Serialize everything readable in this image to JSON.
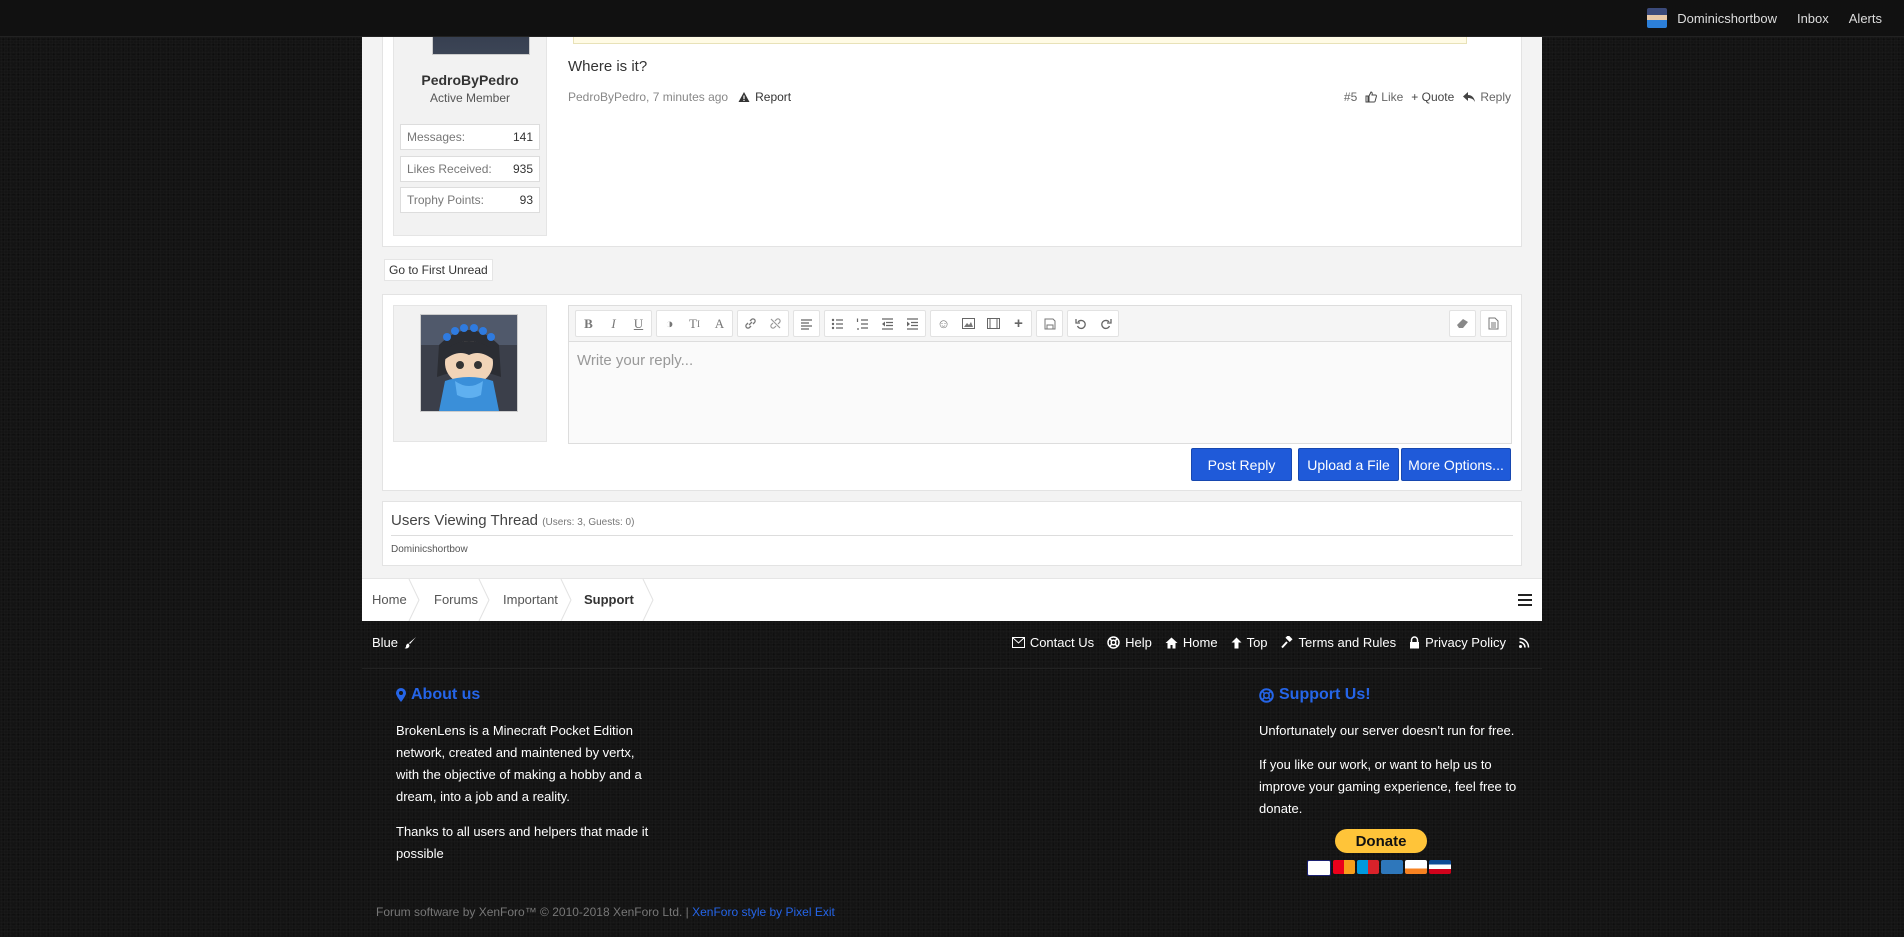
{
  "topbar": {
    "username": "Dominicshortbow",
    "inbox": "Inbox",
    "alerts": "Alerts"
  },
  "post": {
    "author": "PedroByPedro",
    "author_title": "Active Member",
    "stats": [
      {
        "label": "Messages:",
        "value": "141"
      },
      {
        "label": "Likes Received:",
        "value": "935"
      },
      {
        "label": "Trophy Points:",
        "value": "93"
      }
    ],
    "message": "Where is it?",
    "meta_author": "PedroByPedro",
    "meta_time": ", 7 minutes ago",
    "report": "Report",
    "number": "#5",
    "like": "Like",
    "quote": "+ Quote",
    "reply": "Reply"
  },
  "first_unread": "Go to First Unread",
  "reply_box": {
    "placeholder": "Write your reply...",
    "post_reply": "Post Reply",
    "upload": "Upload a File",
    "more": "More Options..."
  },
  "viewers": {
    "title": "Users Viewing Thread",
    "counts": "(Users: 3, Guests: 0)",
    "names": "Dominicshortbow"
  },
  "breadcrumb": [
    "Home",
    "Forums",
    "Important",
    "Support"
  ],
  "footer": {
    "style": "Blue",
    "links": [
      "Contact Us",
      "Help",
      "Home",
      "Top",
      "Terms and Rules",
      "Privacy Policy"
    ],
    "about_title": "About us",
    "about_p1_l1": "BrokenLens is a Minecraft Pocket Edition",
    "about_p1_l2": "network, created and maintened by vertx,",
    "about_p1_l3": "with the objective of making a hobby and a",
    "about_p1_l4": "dream, into a job and a reality.",
    "about_p2_l1": "Thanks to all users and helpers that made it",
    "about_p2_l2": "possible",
    "support_title": "Support Us!",
    "support_p1": "Unfortunately our server doesn't run for free.",
    "support_p2_l1": "If you like our work, or want to help us to",
    "support_p2_l2": "improve your gaming experience, feel free to",
    "support_p2_l3": "donate.",
    "donate": "Donate",
    "copyright": "Forum software by XenForo™ © 2010-2018 XenForo Ltd. |",
    "style_credit": "XenForo style by Pixel Exit"
  },
  "colors": {
    "accent": "#2565e8",
    "button": "#1f5ad9",
    "donate": "#ffc439"
  },
  "icons": [
    "warning-icon",
    "thumbs-up-icon",
    "reply-arrow-icon",
    "hamburger-icon",
    "paintbrush-icon",
    "envelope-icon",
    "lifebuoy-icon",
    "home-icon",
    "arrow-up-icon",
    "gavel-icon",
    "lock-icon",
    "rss-icon",
    "map-marker-icon"
  ]
}
